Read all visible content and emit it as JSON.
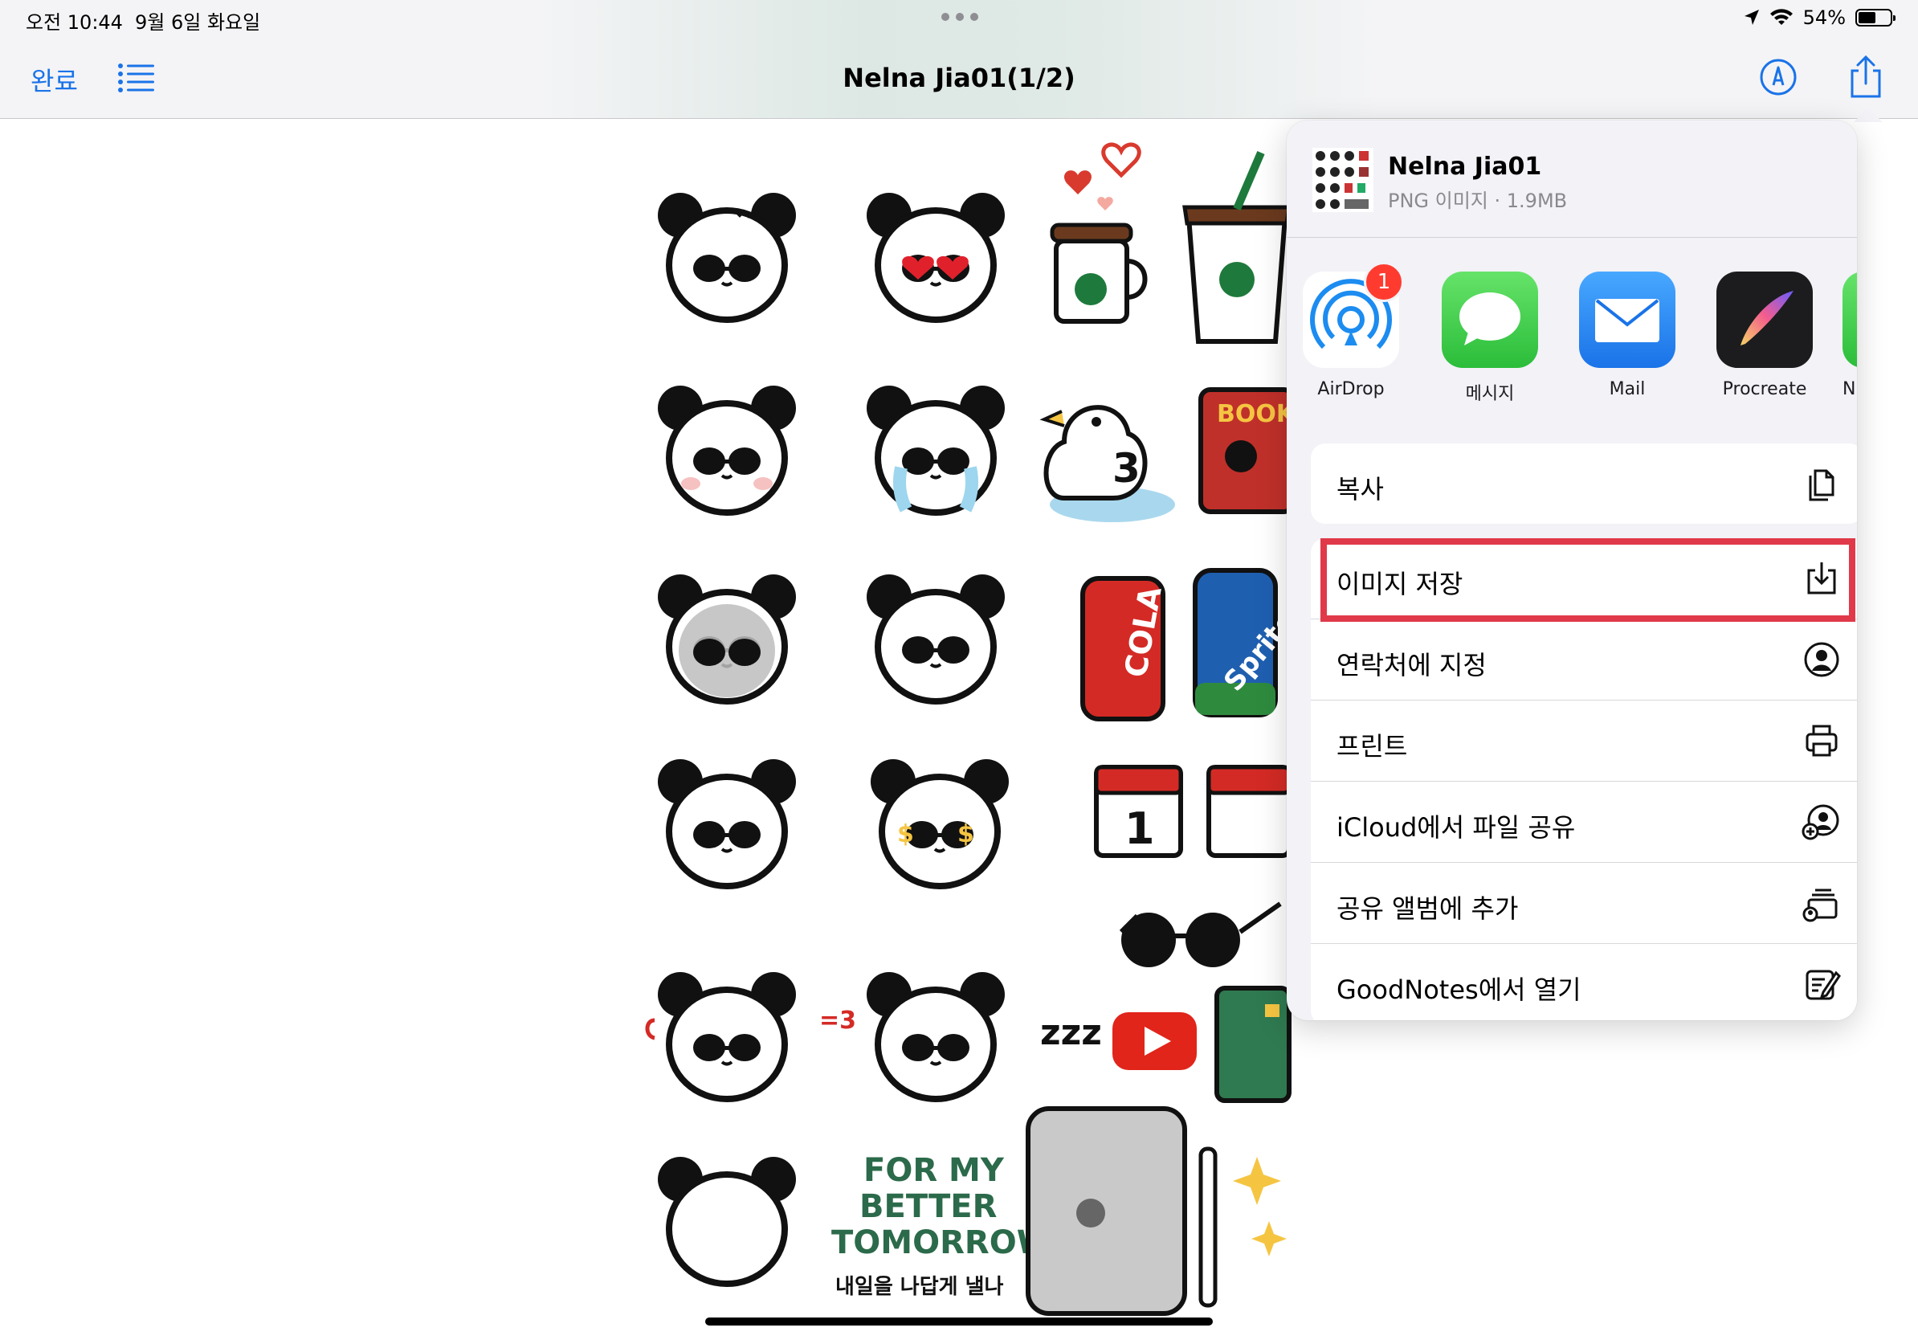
{
  "status_bar": {
    "time": "오전 10:44",
    "date": "9월 6일 화요일",
    "battery_percent": "54%",
    "battery_level": 0.54
  },
  "nav": {
    "done_label": "완료",
    "title": "Nelna Jia01(1/2)",
    "list_icon": "list-icon",
    "markup_icon": "markup-pen-icon",
    "share_icon": "share-icon"
  },
  "sheet": {
    "file_name": "Nelna Jia01",
    "file_meta": "PNG 이미지 · 1.9MB",
    "apps": [
      {
        "label": "AirDrop",
        "icon": "airdrop-icon",
        "badge": "1"
      },
      {
        "label": "메시지",
        "icon": "messages-icon"
      },
      {
        "label": "Mail",
        "icon": "mail-icon"
      },
      {
        "label": "Procreate",
        "icon": "procreate-icon"
      },
      {
        "label": "N",
        "icon": "app-icon-partial"
      }
    ],
    "actions": [
      {
        "label": "복사",
        "icon": "copy-icon"
      },
      {
        "label": "이미지 저장",
        "icon": "save-image-icon",
        "highlighted": true
      },
      {
        "label": "연락처에 지정",
        "icon": "contact-icon"
      },
      {
        "label": "프린트",
        "icon": "print-icon"
      },
      {
        "label": "iCloud에서 파일 공유",
        "icon": "icloud-share-icon"
      },
      {
        "label": "공유 앨범에 추가",
        "icon": "shared-album-icon"
      },
      {
        "label": "GoodNotes에서 열기",
        "icon": "goodnotes-icon"
      }
    ]
  },
  "sticker_text": {
    "book": "BOOK",
    "cola": "COLA",
    "sprite": "Sprite",
    "calendar_day": "1",
    "duck_number": "3",
    "zzz": "zzz",
    "for_my": "FOR MY",
    "better": "BETTER",
    "tomorrow": "TOMORROW",
    "korean_slogan": "내일을 나답게 낼나"
  },
  "colors": {
    "accent": "#1a73e8",
    "highlight": "#e0394a",
    "badge": "#ff3b30"
  }
}
